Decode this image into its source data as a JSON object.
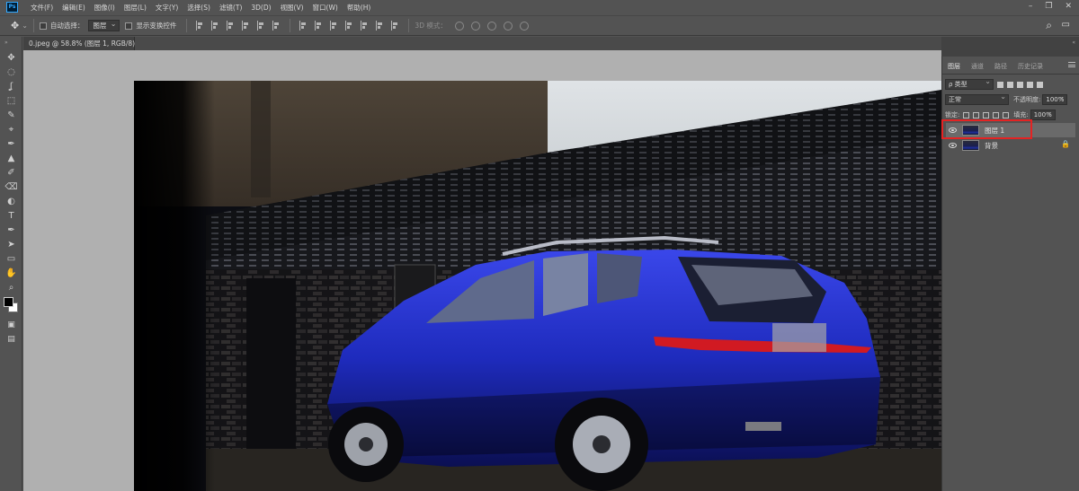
{
  "app": {
    "logo": "Ps",
    "menu": [
      "文件(F)",
      "编辑(E)",
      "图像(I)",
      "图层(L)",
      "文字(Y)",
      "选择(S)",
      "滤镜(T)",
      "3D(D)",
      "视图(V)",
      "窗口(W)",
      "帮助(H)"
    ],
    "window_controls": [
      "–",
      "❐",
      "✕"
    ]
  },
  "options_bar": {
    "move_tool_icon": "✥",
    "auto_select_label": "自动选择：",
    "auto_select_value": "图层",
    "show_transform_label": "显示变换控件",
    "mode_3d_label": "3D 模式：",
    "search_icon": "⌕",
    "workspace_icon": "▭"
  },
  "document": {
    "tab_label": "0.jpeg @ 58.8% (图层 1, RGB/8) *",
    "tab_close": "×"
  },
  "tools": [
    "✥",
    "◌",
    "ʆ",
    "⬚",
    "✎",
    "⌖",
    "✒",
    "▲",
    "✐",
    "⌫",
    "◐",
    "T",
    "✒",
    "➤",
    "▭",
    "✋",
    "⌕"
  ],
  "layers_panel": {
    "tabs": [
      "图层",
      "通道",
      "路径",
      "历史记录"
    ],
    "active_tab": 0,
    "filter_label": "ρ 类型",
    "blend_mode": "正常",
    "opacity_label": "不透明度:",
    "opacity_value": "100%",
    "lock_label": "锁定:",
    "fill_label": "填充:",
    "fill_value": "100%",
    "layers": [
      {
        "name": "图层 1",
        "selected": true,
        "locked": false
      },
      {
        "name": "背景",
        "selected": false,
        "locked": true
      }
    ],
    "highlight_color": "#e42323"
  },
  "colors": {
    "ui_bg": "#535353",
    "canvas_bg": "#b0b0b0",
    "car_blue": "#1f2cc4",
    "taillight_red": "#d11a22"
  }
}
